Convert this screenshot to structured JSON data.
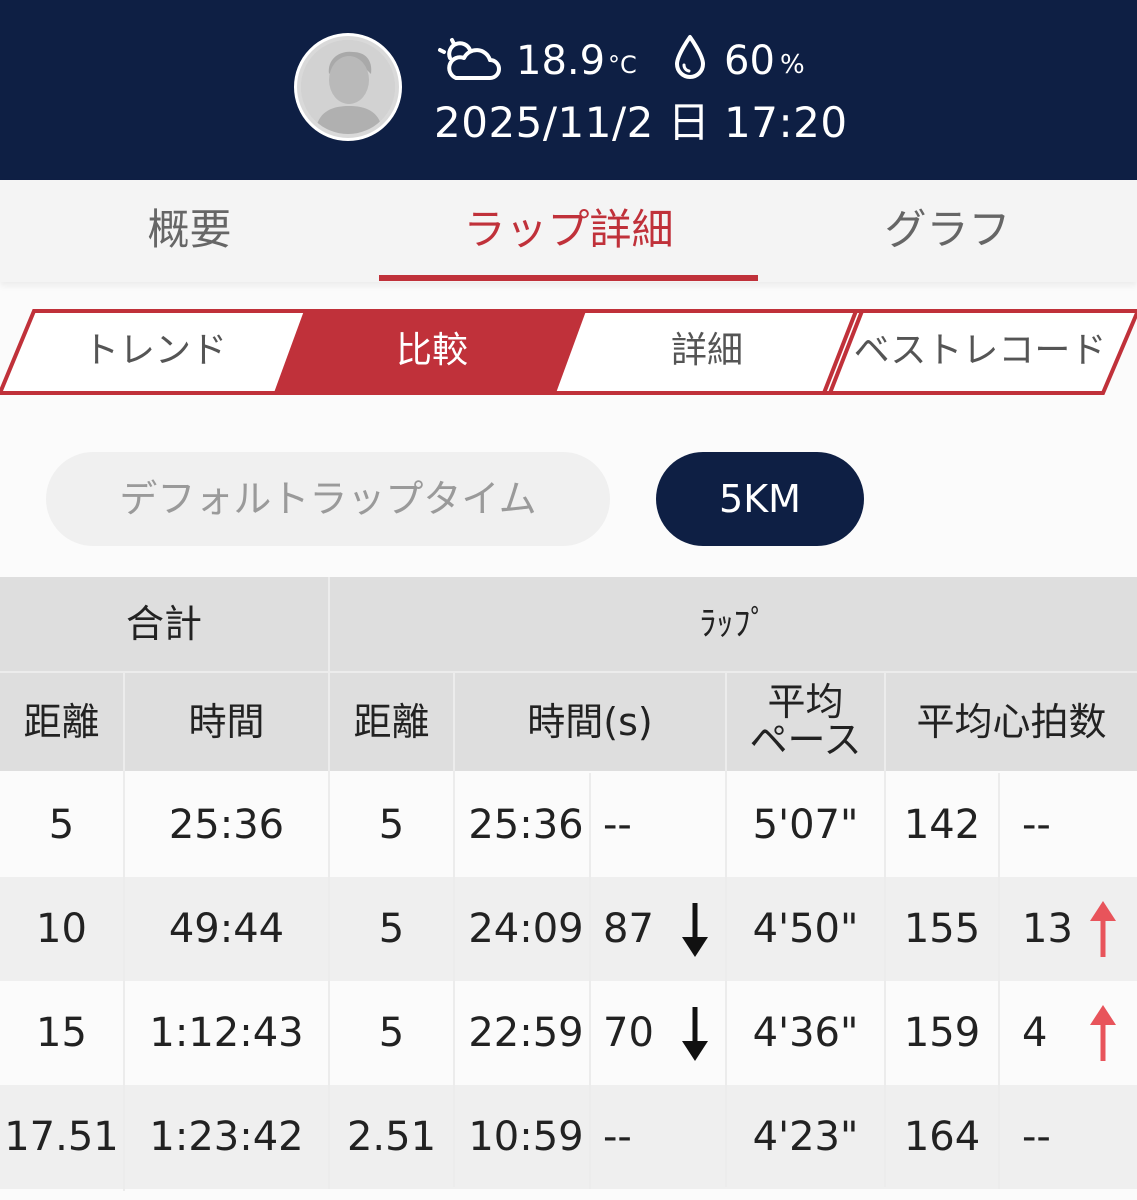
{
  "header": {
    "weather_icon": "cloud-sun-icon",
    "temperature": "18.9",
    "temperature_unit": "°C",
    "humidity_icon": "water-drop-icon",
    "humidity": "60",
    "humidity_unit": "%",
    "datetime": "2025/11/2 日 17:20"
  },
  "tabs": [
    {
      "label": "概要",
      "active": false
    },
    {
      "label": "ラップ詳細",
      "active": true
    },
    {
      "label": "グラフ",
      "active": false
    }
  ],
  "subtabs": [
    {
      "label": "トレンド",
      "active": false
    },
    {
      "label": "比較",
      "active": true
    },
    {
      "label": "詳細",
      "active": false
    },
    {
      "label": "ベストレコード",
      "active": false
    }
  ],
  "mode_toggle": [
    {
      "label": "デフォルトラップタイム",
      "active": false
    },
    {
      "label": "5KM",
      "active": true
    }
  ],
  "table": {
    "group_headers": {
      "total": "合計",
      "lap": "ﾗｯﾌﾟ"
    },
    "columns": {
      "total_distance": "距離",
      "total_time": "時間",
      "lap_distance": "距離",
      "lap_time": "時間(s)",
      "avg_pace_1": "平均",
      "avg_pace_2": "ペース",
      "avg_hr": "平均心拍数"
    },
    "rows": [
      {
        "total_distance": "5",
        "total_time": "25:36",
        "lap_distance": "5",
        "lap_time": "25:36",
        "time_diff": "--",
        "time_trend": "none",
        "pace": "5'07\"",
        "hr": "142",
        "hr_diff": "--",
        "hr_trend": "none"
      },
      {
        "total_distance": "10",
        "total_time": "49:44",
        "lap_distance": "5",
        "lap_time": "24:09",
        "time_diff": "87",
        "time_trend": "down",
        "pace": "4'50\"",
        "hr": "155",
        "hr_diff": "13",
        "hr_trend": "up"
      },
      {
        "total_distance": "15",
        "total_time": "1:12:43",
        "lap_distance": "5",
        "lap_time": "22:59",
        "time_diff": "70",
        "time_trend": "down",
        "pace": "4'36\"",
        "hr": "159",
        "hr_diff": "4",
        "hr_trend": "up"
      },
      {
        "total_distance": "17.51",
        "total_time": "1:23:42",
        "lap_distance": "2.51",
        "lap_time": "10:59",
        "time_diff": "--",
        "time_trend": "none",
        "pace": "4'23\"",
        "hr": "164",
        "hr_diff": "--",
        "hr_trend": "none"
      }
    ]
  },
  "colors": {
    "navy": "#0e1f44",
    "accent_red": "#c0313a",
    "arrow_up": "#e8545b",
    "arrow_down": "#111111"
  }
}
